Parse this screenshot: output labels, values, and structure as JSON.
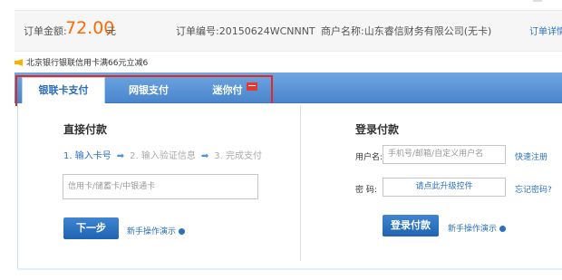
{
  "order": {
    "amount_label": "订单金额:",
    "amount_value": "72.00",
    "amount_unit": "元",
    "order_no": "订单编号:20150624WCNNNT",
    "merchant": "商户名称:山东睿信财务有限公司(无卡)",
    "details_link": "订单详情"
  },
  "promo": {
    "text": "北京银行银联信用卡满66元立减6"
  },
  "tabs": [
    {
      "label": "银联卡支付",
      "active": true
    },
    {
      "label": "网银支付",
      "active": false
    },
    {
      "label": "迷你付",
      "active": false,
      "badge": "hot"
    }
  ],
  "direct": {
    "title": "直接付款",
    "step1": "1. 输入卡号",
    "step2": "2. 输入验证信息",
    "step3": "3. 完成支付",
    "card_placeholder": "信用卡/储蓄卡/中银通卡",
    "next_label": "下一步",
    "guide_label": "新手操作演示"
  },
  "login": {
    "title": "登录付款",
    "username_label": "用户名:",
    "username_placeholder": "手机号/邮箱/自定义用户名",
    "register_link": "快速注册",
    "password_label": "密  码:",
    "plugin_text": "请点此升级控件",
    "forgot_link": "忘记密码?",
    "login_label": "登录付款",
    "guide_label": "新手操作演示"
  },
  "colors": {
    "accent": "#2b71c0",
    "amount": "#ff6a00",
    "highlight_box": "#e02a22",
    "tab_bar": "#4a86cd"
  }
}
